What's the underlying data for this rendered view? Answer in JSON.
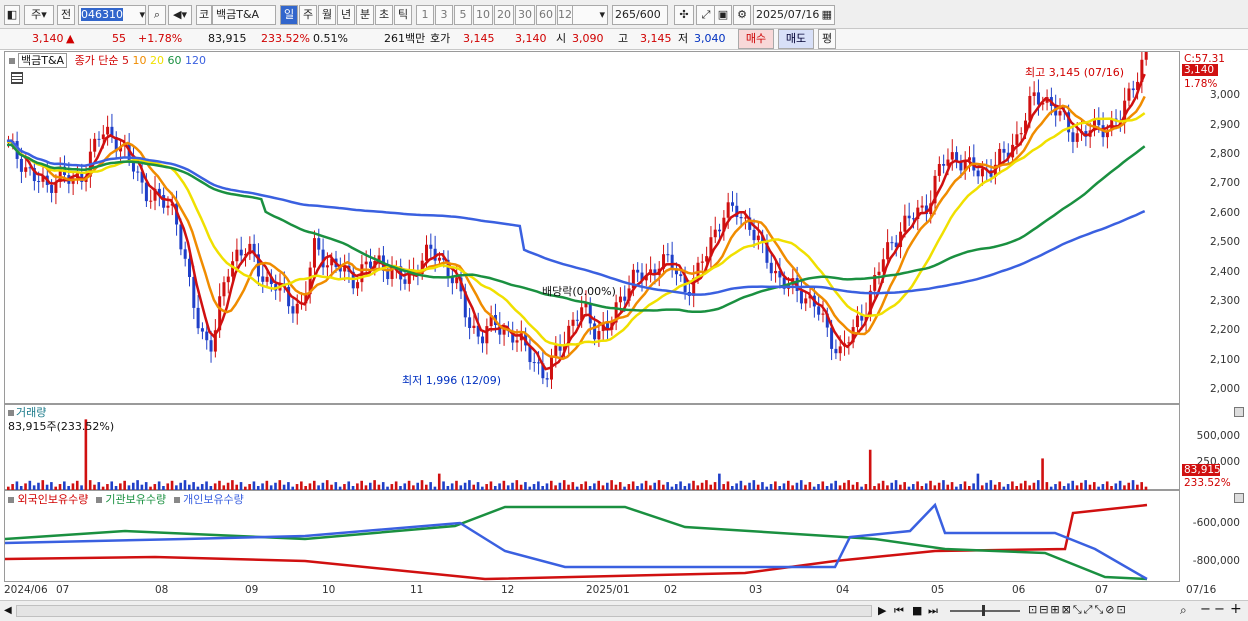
{
  "toolbar": {
    "market_select": "주",
    "prev_label": "전",
    "code": "046310",
    "code_prefix": "코",
    "stock_name": "백금T&A",
    "periods": [
      "일",
      "주",
      "월",
      "년",
      "분",
      "초",
      "틱"
    ],
    "intervals": [
      "1",
      "3",
      "5",
      "10",
      "20",
      "30",
      "60",
      "120"
    ],
    "count": "265",
    "count_total": "/600",
    "date": "2025/07/16"
  },
  "quote": {
    "price": "3,140",
    "arrow": "▲",
    "change": "55",
    "change_pct": "+1.78%",
    "volume": "83,915",
    "volume_ratio": "233.52%",
    "turnover_pct": "0.51%",
    "amount": "261백만",
    "open_label": "호가",
    "ask": "3,145",
    "bid": "3,140",
    "open_label2": "시",
    "open": "3,090",
    "high_label": "고",
    "high": "3,145",
    "low_label": "저",
    "low": "3,040",
    "buy_label": "매수",
    "sell_label": "매도",
    "eval_label": "평"
  },
  "price_pane": {
    "title": "백금T&A",
    "ma_label": "종가 단순",
    "ma_periods": [
      "5",
      "10",
      "20",
      "60",
      "120"
    ],
    "ma_colors": [
      "#d01010",
      "#f08c00",
      "#f0e000",
      "#1a9040",
      "#3a60e0"
    ],
    "high_annotation": "최고 3,145 (07/16)",
    "low_annotation": "최저 1,996 (12/09)",
    "dividend_annotation": "배당락(0.00%)",
    "axis_top_label": "C:57.31",
    "last_price_tag": "3,140",
    "last_pct_tag": "1.78%",
    "y_ticks": [
      "3,000",
      "2,900",
      "2,800",
      "2,700",
      "2,600",
      "2,500",
      "2,400",
      "2,300",
      "2,200",
      "2,100",
      "2,000"
    ]
  },
  "volume_pane": {
    "title": "거래량",
    "value_label": "83,915주(233.52%)",
    "y_ticks": [
      "500,000",
      "250,000"
    ],
    "last_tag": "83,915",
    "last_pct_tag": "233.52%"
  },
  "holding_pane": {
    "legend": [
      "외국인보유수량",
      "기관보유수량",
      "개인보유수량"
    ],
    "legend_colors": [
      "#d01010",
      "#1a9040",
      "#3a60e0"
    ],
    "y_ticks": [
      "-600,000",
      "-800,000"
    ]
  },
  "x_axis": {
    "labels": [
      "2024/06",
      "07",
      "08",
      "09",
      "10",
      "11",
      "12",
      "2025/01",
      "02",
      "03",
      "04",
      "05",
      "06",
      "07"
    ],
    "end_label": "07/16"
  },
  "chart_data": {
    "type": "candlestick",
    "price_range": [
      1950,
      3150
    ],
    "ma_closes_key": [
      "MA5",
      "MA10",
      "MA20",
      "MA60",
      "MA120"
    ],
    "close_series": [
      2830,
      2780,
      2720,
      2690,
      2740,
      2700,
      2750,
      2860,
      2880,
      2810,
      2740,
      2660,
      2640,
      2620,
      2380,
      2200,
      2150,
      2400,
      2480,
      2460,
      2380,
      2350,
      2300,
      2280,
      2500,
      2430,
      2410,
      2380,
      2420,
      2440,
      2400,
      2370,
      2430,
      2470,
      2440,
      2360,
      2230,
      2180,
      2230,
      2200,
      2160,
      2120,
      2030,
      2150,
      2220,
      2280,
      2200,
      2210,
      2330,
      2390,
      2380,
      2450,
      2420,
      2340,
      2400,
      2520,
      2600,
      2610,
      2560,
      2470,
      2400,
      2350,
      2330,
      2300,
      2200,
      2130,
      2190,
      2280,
      2400,
      2500,
      2560,
      2600,
      2640,
      2770,
      2800,
      2760,
      2740,
      2760,
      2800,
      2870,
      2980,
      3000,
      2950,
      2880,
      2870,
      2890,
      2900,
      2920,
      3050,
      3140
    ],
    "volume_series_peaks": [
      {
        "label": "07",
        "value": 660000
      },
      {
        "label": "04",
        "value": 380000
      },
      {
        "label": "06",
        "value": 300000
      }
    ]
  }
}
